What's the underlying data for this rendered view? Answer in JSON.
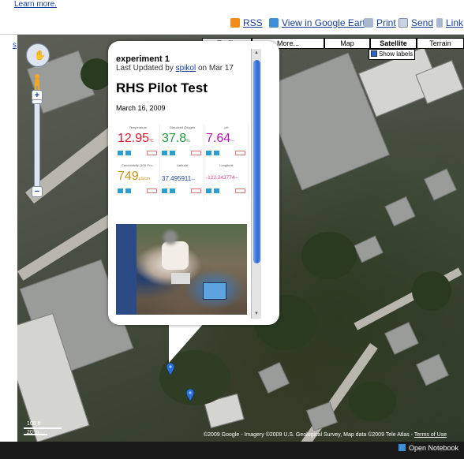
{
  "top": {
    "learn_more": "Learn more."
  },
  "links": {
    "rss": "RSS",
    "google_earth": "View in Google Earth",
    "print": "Print",
    "send": "Send",
    "link": "Link",
    "left_link": "s"
  },
  "map_types": {
    "traffic": "Traffic",
    "more": "More...",
    "map": "Map",
    "satellite": "Satellite",
    "terrain": "Terrain",
    "active": "Satellite",
    "show_labels": "Show labels"
  },
  "popup": {
    "name": "experiment 1",
    "updated_prefix": "Last Updated by",
    "updated_user": "spikol",
    "updated_suffix": "on Mar 17",
    "heading": "RHS Pilot Test",
    "date": "March 16, 2009",
    "sensors": [
      [
        {
          "label": "Temperature",
          "value": "12.95",
          "unit": "°C",
          "color": "#e0162b"
        },
        {
          "label": "Dissolved Oxygen",
          "value": "37.8",
          "unit": "%",
          "color": "#1e9b3a"
        },
        {
          "label": "pH",
          "value": "7.64",
          "unit": "—",
          "color": "#b514b5"
        }
      ],
      [
        {
          "label": "Conductivity (10X Pro...",
          "value": "749",
          "unit": "µS/cm",
          "color": "#c9941a"
        },
        {
          "label": "Latitude",
          "value": "37.495911",
          "unit": "—",
          "color": "#1a3f9b"
        },
        {
          "label": "Longitude",
          "value": "-122.243774",
          "unit": "—",
          "color": "#e33a8c"
        }
      ]
    ]
  },
  "map_footer": {
    "scale_top": "100 ft",
    "scale_bottom": "20 m",
    "copyright": "©2009 Google - Imagery ©2009 U.S. Geological Survey, Map data ©2009 Tele Atlas -",
    "terms": "Terms of Use",
    "open_notebook": "Open Notebook"
  },
  "colors": {
    "link_blue": "#1a3f9b",
    "scroll_thumb": "#2d6bd4",
    "marker_blue": "#2c6fd8"
  }
}
